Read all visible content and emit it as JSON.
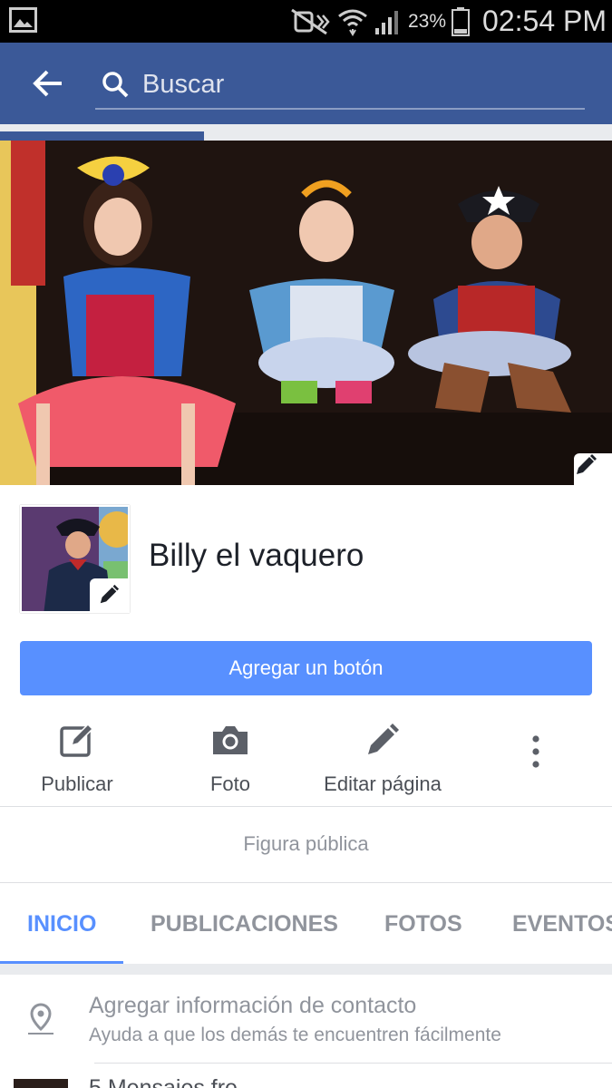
{
  "status_bar": {
    "battery": "23%",
    "time": "02:54 PM"
  },
  "header": {
    "search_placeholder": "Buscar"
  },
  "progress": {
    "fraction": 0.333
  },
  "page": {
    "name": "Billy el vaquero",
    "add_button_label": "Agregar un botón",
    "category": "Figura pública"
  },
  "actions": [
    {
      "label": "Publicar",
      "icon": "compose-icon"
    },
    {
      "label": "Foto",
      "icon": "camera-icon"
    },
    {
      "label": "Editar página",
      "icon": "pencil-icon"
    }
  ],
  "tabs": [
    {
      "label": "INICIO",
      "active": true
    },
    {
      "label": "PUBLICACIONES",
      "active": false
    },
    {
      "label": "FOTOS",
      "active": false
    },
    {
      "label": "EVENTOS",
      "active": false
    }
  ],
  "contact": {
    "title": "Agregar información de contacto",
    "subtitle": "Ayuda a que los demás te encuentren fácilmente"
  },
  "next_item": {
    "text": "5 Mensajes fre..."
  },
  "colors": {
    "header": "#3b5998",
    "accent": "#5890ff",
    "muted": "#90949c"
  }
}
